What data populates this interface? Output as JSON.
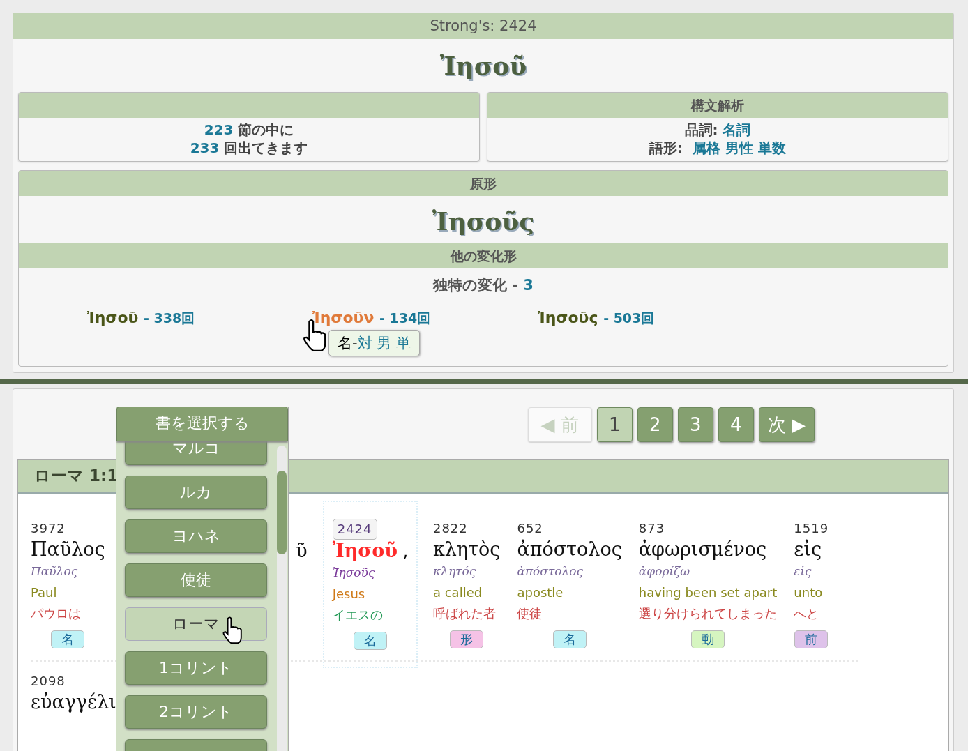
{
  "strongs": {
    "label": "Strong's: 2424",
    "word": "Ἰησοῦ"
  },
  "occurrence": {
    "verses_count": "223",
    "verses_text": "節の中に",
    "times_count": "233",
    "times_text": "回出てきます"
  },
  "parsing": {
    "title": "構文解析",
    "pos_label": "品詞:",
    "pos_value": "名詞",
    "form_label": "語形:",
    "form_values": [
      "属格",
      "男性",
      "単数"
    ]
  },
  "lemma": {
    "title": "原形",
    "word": "Ἰησοῦς",
    "variants_title": "他の変化形",
    "unique_label": "独特の変化 - ",
    "unique_count": "3",
    "forms": [
      {
        "word": "Ἰησοῦ",
        "count": "- 338回",
        "selected": false
      },
      {
        "word": "Ἰησοῦν",
        "count": "- 134回",
        "selected": true
      },
      {
        "word": "Ἰησοῦς",
        "count": "- 503回",
        "selected": false
      }
    ],
    "tooltip": {
      "pos": "名-",
      "parts": [
        "対",
        "男",
        "単"
      ]
    }
  },
  "book_menu": {
    "title": "書を選択する",
    "items": [
      {
        "label": "マルコ",
        "selected": false
      },
      {
        "label": "ルカ",
        "selected": false
      },
      {
        "label": "ヨハネ",
        "selected": false
      },
      {
        "label": "使徒",
        "selected": false
      },
      {
        "label": "ローマ",
        "selected": true
      },
      {
        "label": "1コリント",
        "selected": false
      },
      {
        "label": "2コリント",
        "selected": false
      }
    ]
  },
  "pagination": {
    "prev": "◀ 前",
    "prev_disabled": true,
    "pages": [
      {
        "label": "1",
        "selected": true
      },
      {
        "label": "2",
        "selected": false
      },
      {
        "label": "3",
        "selected": false
      },
      {
        "label": "4",
        "selected": false
      }
    ],
    "next": "次 ▶"
  },
  "verse": {
    "reference": "ローマ 1:1",
    "rows": [
      [
        {
          "kind": "word",
          "number": "3972",
          "greek": "Παῦλος",
          "lemma": "Παῦλος",
          "english": "Paul",
          "japanese": "パウロは",
          "pos": {
            "label": "名",
            "color": "#c0f2f6"
          },
          "selected": false
        },
        {
          "kind": "covered",
          "greek": "ῦ"
        },
        {
          "kind": "word",
          "number": "2424",
          "greek": "Ἰησοῦ",
          "punct": ",",
          "lemma": "Ἰησοῦς",
          "english": "Jesus",
          "japanese": "イエスの",
          "pos": {
            "label": "名",
            "color": "#c0f2f6"
          },
          "selected": true
        },
        {
          "kind": "word",
          "number": "2822",
          "greek": "κλητὸς",
          "lemma": "κλητός",
          "english": "a called",
          "japanese": "呼ばれた者",
          "pos": {
            "label": "形",
            "color": "#f5c2e6"
          },
          "selected": false
        },
        {
          "kind": "word",
          "number": "652",
          "greek": "ἀπόστολος",
          "lemma": "ἀπόστολος",
          "english": "apostle",
          "japanese": "使徒",
          "pos": {
            "label": "名",
            "color": "#c0f2f6"
          },
          "selected": false
        },
        {
          "kind": "word",
          "number": "873",
          "greek": "ἀφωρισμένος",
          "lemma": "ἀφορίζω",
          "english": "having been set apart",
          "japanese": "選り分けられてしまった",
          "pos": {
            "label": "動",
            "color": "#d6f5c0"
          },
          "selected": false
        },
        {
          "kind": "word",
          "number": "1519",
          "greek": "εἰς",
          "lemma": "εἰς",
          "english": "unto",
          "japanese": "へと",
          "pos": {
            "label": "前",
            "color": "#dec2ea"
          },
          "selected": false
        }
      ],
      [
        {
          "kind": "word",
          "number": "2098",
          "greek": "εὐαγγέλι",
          "selected": false
        }
      ]
    ]
  }
}
